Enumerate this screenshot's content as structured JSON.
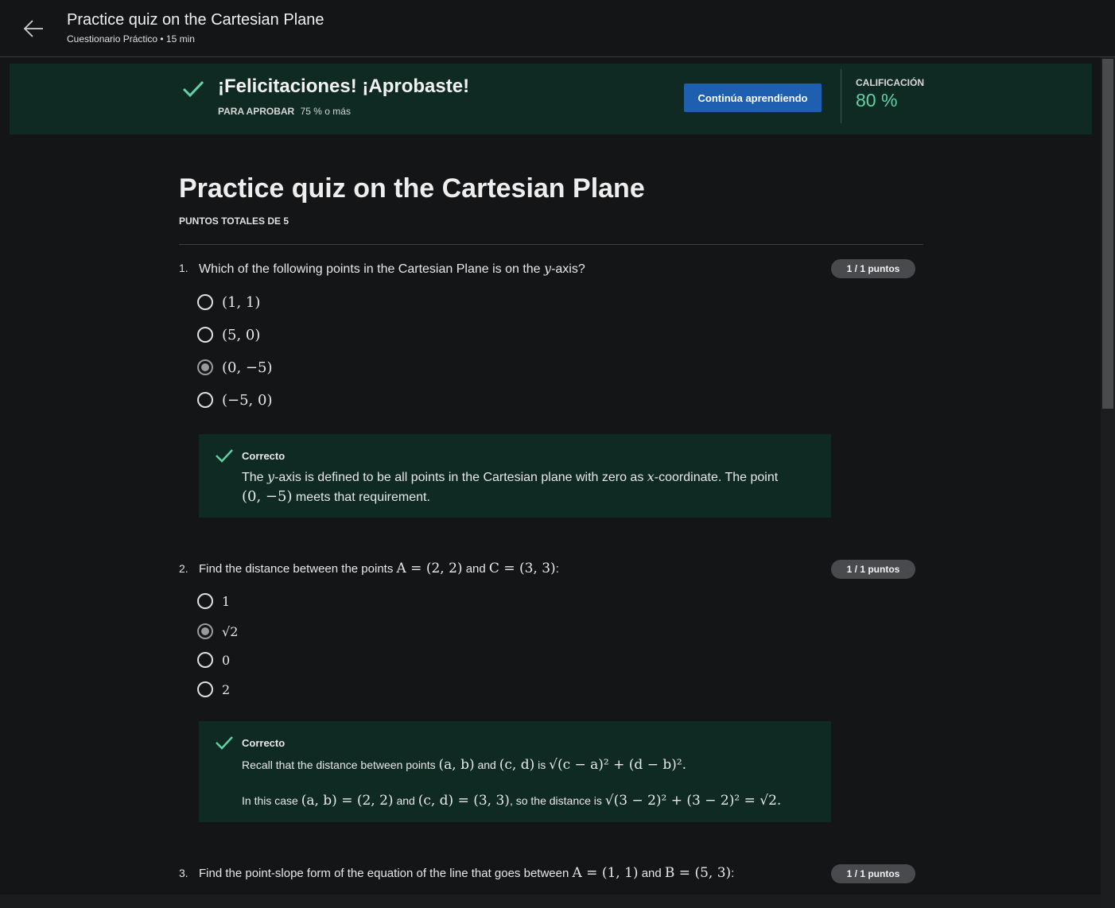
{
  "header": {
    "title": "Practice quiz on the Cartesian Plane",
    "subtitle": "Cuestionario Práctico • 15 min"
  },
  "banner": {
    "title": "¡Felicitaciones! ¡Aprobaste!",
    "pass_label": "PARA APROBAR",
    "pass_value": "75 % o más",
    "continue_button": "Continúa aprendiendo",
    "grade_label": "CALIFICACIÓN",
    "grade_value": "80 %",
    "accent_color": "#5fd3a6"
  },
  "main": {
    "title": "Practice quiz on the Cartesian Plane",
    "total_points": "PUNTOS TOTALES DE 5"
  },
  "questions": [
    {
      "number": "1.",
      "text_before": "Which of the following points in the Cartesian Plane is on the ",
      "text_var": "y",
      "text_after": "-axis?",
      "badge": "1 / 1 puntos",
      "options": [
        "(1, 1)",
        "(5, 0)",
        "(0, −5)",
        "(−5, 0)"
      ],
      "selected_index": 2,
      "feedback": {
        "title": "Correcto",
        "line1_a": "The ",
        "line1_var1": "y",
        "line1_b": "-axis is defined to be all points in the Cartesian plane with zero as ",
        "line1_var2": "x",
        "line1_c": "-coordinate. The point",
        "line2_math": "(0, −5)",
        "line2_text": " meets that requirement."
      }
    },
    {
      "number": "2.",
      "text_a": "Find the distance between the points ",
      "math_a": "A = (2, 2)",
      "text_b": " and ",
      "math_b": "C = (3, 3)",
      "text_c": ":",
      "badge": "1 / 1 puntos",
      "options": [
        "1",
        "√2",
        "0",
        "2"
      ],
      "selected_index": 1,
      "feedback": {
        "title": "Correcto",
        "l1_a": "Recall that the distance between points ",
        "l1_m1": "(a, b)",
        "l1_b": " and ",
        "l1_m2": "(c, d)",
        "l1_c": " is ",
        "l1_m3": "√(c − a)² + (d − b)².",
        "l2_a": "In this case ",
        "l2_m1": "(a, b) = (2, 2)",
        "l2_b": " and ",
        "l2_m2": "(c, d) = (3, 3)",
        "l2_c": ", so the distance is ",
        "l2_m3": "√(3 − 2)² + (3 − 2)² = √2."
      }
    },
    {
      "number": "3.",
      "text_a": "Find the point-slope form of the equation of the line that goes between ",
      "math_a": "A = (1, 1)",
      "text_b": " and ",
      "math_b": "B = (5, 3)",
      "text_c": ":",
      "badge": "1 / 1 puntos"
    }
  ]
}
